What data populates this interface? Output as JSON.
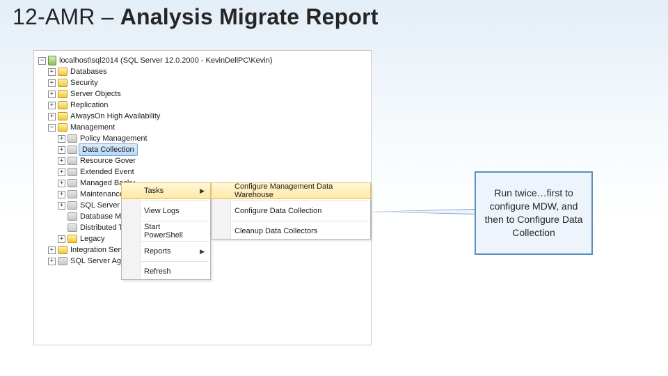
{
  "title_plain": "12-AMR – ",
  "title_bold": "Analysis Migrate Report",
  "root": {
    "label": "localhost\\sql2014 (SQL Server 12.0.2000 - KevinDellPC\\Kevin)"
  },
  "top_nodes": [
    {
      "label": "Databases"
    },
    {
      "label": "Security"
    },
    {
      "label": "Server Objects"
    },
    {
      "label": "Replication"
    },
    {
      "label": "AlwaysOn High Availability"
    }
  ],
  "mgmt": {
    "label": "Management"
  },
  "mgmt_children": [
    {
      "label": "Policy Management",
      "exp": "+"
    },
    {
      "label": "Data Collection",
      "exp": "+",
      "sel": true
    },
    {
      "label": "Resource Gover",
      "exp": "+"
    },
    {
      "label": "Extended Event",
      "exp": "+"
    },
    {
      "label": "Managed Backu",
      "exp": "+"
    },
    {
      "label": "Maintenance Pl",
      "exp": "+"
    },
    {
      "label": "SQL Server Log",
      "exp": "+"
    },
    {
      "label": "Database Mail",
      "exp": ""
    },
    {
      "label": "Distributed Tran",
      "exp": ""
    },
    {
      "label": "Legacy",
      "exp": "+"
    }
  ],
  "bottom_nodes": [
    {
      "label": "Integration Services Catalogs"
    },
    {
      "label": "SQL Server Agent (Agent XPs disabled)"
    }
  ],
  "ctx1": [
    {
      "label": "Tasks",
      "arrow": true,
      "hov": true
    },
    {
      "sep": true
    },
    {
      "label": "View Logs"
    },
    {
      "sep": true
    },
    {
      "label": "Start PowerShell"
    },
    {
      "sep": true
    },
    {
      "label": "Reports",
      "arrow": true
    },
    {
      "sep": true
    },
    {
      "label": "Refresh"
    }
  ],
  "ctx2": [
    {
      "label": "Configure Management Data Warehouse",
      "hov": true
    },
    {
      "sep": true
    },
    {
      "label": "Configure Data Collection"
    },
    {
      "sep": true
    },
    {
      "label": "Cleanup Data Collectors"
    }
  ],
  "callout": "Run twice…first to configure MDW, and then to Configure Data Collection"
}
